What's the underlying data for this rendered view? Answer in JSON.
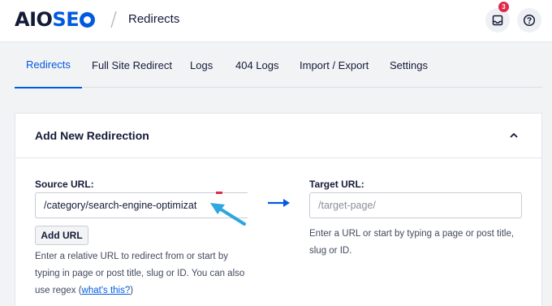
{
  "header": {
    "logo_prefix": "AIO",
    "logo_suffix": "SE",
    "page_title": "Redirects",
    "notification_count": "3"
  },
  "tabs": [
    {
      "label": "Redirects",
      "active": true
    },
    {
      "label": "Full Site Redirect",
      "active": false
    },
    {
      "label": "Logs",
      "active": false
    },
    {
      "label": "404 Logs",
      "active": false
    },
    {
      "label": "Import / Export",
      "active": false
    },
    {
      "label": "Settings",
      "active": false
    }
  ],
  "card": {
    "title": "Add New Redirection",
    "source": {
      "label": "Source URL:",
      "value": "/category/search-engine-optimizat",
      "add_button": "Add URL",
      "help_text": "Enter a relative URL to redirect from or start by typing in page or post title, slug or ID. You can also use regex (",
      "help_link": "what's this?",
      "help_close": ")"
    },
    "target": {
      "label": "Target URL:",
      "placeholder": "/target-page/",
      "help_text": "Enter a URL or start by typing a page or post title, slug or ID."
    }
  },
  "colors": {
    "accent": "#005ae0",
    "badge": "#df2a4a",
    "pointer_arrow": "#2ea6de"
  }
}
